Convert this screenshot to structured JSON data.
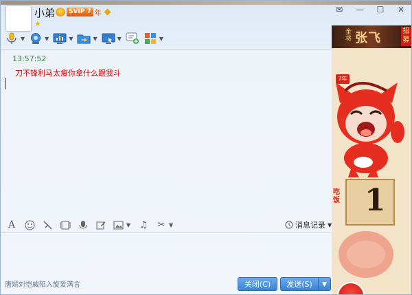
{
  "header": {
    "contact_name": "小弟",
    "svip_badge": "SVIP 7",
    "svip_year": "年",
    "star": "★"
  },
  "window_buttons": {
    "skin": "✉",
    "minimize": "—",
    "maximize": "☐",
    "close": "✕"
  },
  "toolbar": {
    "items": [
      "voice-call",
      "video-call",
      "remote-desktop",
      "transfer-file",
      "share-screen",
      "create-discussion",
      "apps"
    ]
  },
  "chat": {
    "time": "13:57:52",
    "message": "刀不锋利马太瘦你拿什么跟我斗"
  },
  "input_toolbar": {
    "history_label": "消息记录"
  },
  "footer": {
    "ad_text": "唐嫣刘恺威陷入旋爱满言",
    "close_label": "关闭(C)",
    "send_label": "发送(S)",
    "send_dropdown": "▼"
  },
  "side_panel": {
    "banner_title": "张飞",
    "banner_small": "金将",
    "banner_tag": "招募",
    "ribbon": "7年",
    "pedestal_number": "1",
    "side_text": "吃饭"
  },
  "colors": {
    "time": "#2f8a2f",
    "message": "#d40000",
    "button": "#3a82d6"
  }
}
